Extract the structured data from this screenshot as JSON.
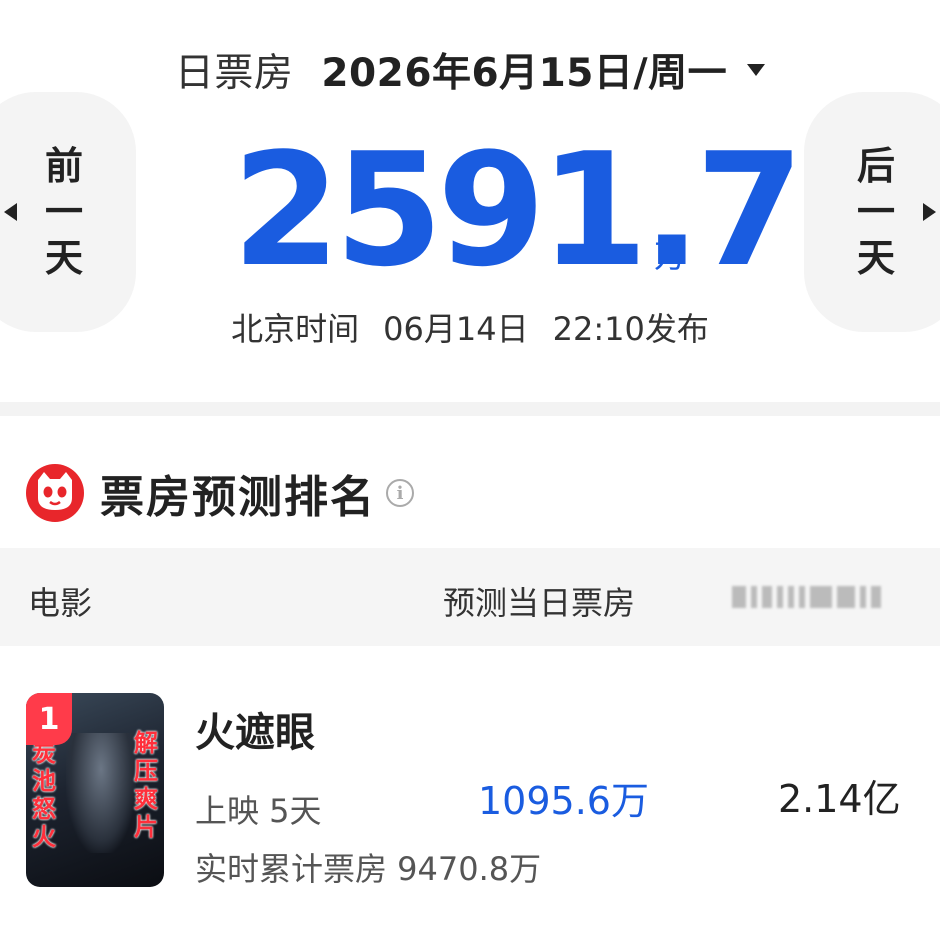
{
  "header": {
    "label": "日票房",
    "date": "2026年6月15日/周一",
    "prev_day": "前一天",
    "next_day": "后一天"
  },
  "summary": {
    "total_box_office": "2591.7",
    "unit": "万",
    "publish_prefix": "北京时间",
    "publish_date": "06月14日",
    "publish_time": "22:10发布"
  },
  "ranking": {
    "title": "票房预测排名",
    "info_icon": "info-icon",
    "logo_icon": "cat-logo-icon",
    "columns": [
      "电影",
      "预测当日票房"
    ],
    "rows": [
      {
        "rank": "1",
        "title": "火遮眼",
        "poster_text_left": "炭池怒火",
        "poster_text_right": "解压爽片",
        "days": "上映 5天",
        "cumulative": "实时累计票房 9470.8万",
        "forecast": "1095.6万",
        "third_col": "2.14亿"
      }
    ]
  },
  "colors": {
    "accent_blue": "#1a5ce0",
    "badge_red": "#ff3b4a",
    "logo_red": "#e8262b"
  }
}
